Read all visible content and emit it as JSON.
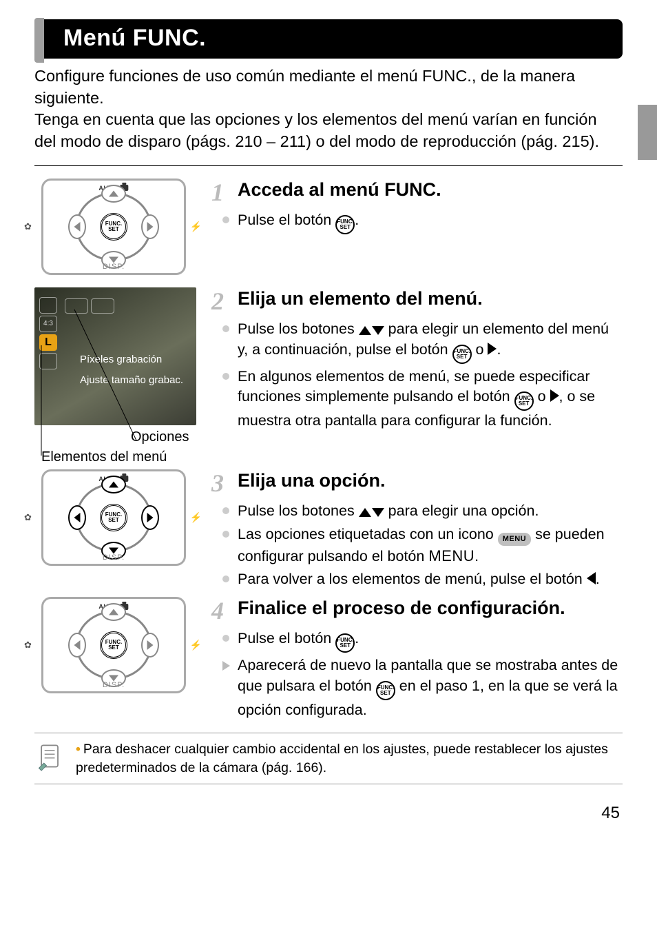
{
  "title": "Menú FUNC.",
  "intro": {
    "p1": "Configure funciones de uso común mediante el menú FUNC., de la manera siguiente.",
    "p2": "Tenga en cuenta que las opciones y los elementos del menú varían en función del modo de disparo (págs. 210 – 211) o del modo de reproducción (pág. 215)."
  },
  "labels": {
    "auto": "AUTO",
    "disp": "DISP.",
    "func_set": "FUNC. SET",
    "menu_pill": "MENU",
    "menu_word": "MENU"
  },
  "screenshot": {
    "strip": [
      "",
      "4:3",
      "L",
      ""
    ],
    "label1": "Píxeles grabación",
    "label2": "Ajuste tamaño grabac."
  },
  "captions": {
    "opciones": "Opciones",
    "elementos": "Elementos del menú"
  },
  "steps": [
    {
      "num": "1",
      "title": "Acceda al menú FUNC.",
      "items": [
        {
          "kind": "dot",
          "pre": "Pulse el botón ",
          "icon": "func",
          "post": "."
        }
      ]
    },
    {
      "num": "2",
      "title": "Elija un elemento del menú.",
      "items": [
        {
          "kind": "dot",
          "pre": "Pulse los botones ",
          "icon": "updown",
          "mid": " para elegir un elemento del menú y, a continuación, pulse el botón ",
          "icon2": "func",
          "mid2": " o ",
          "icon3": "right",
          "post": "."
        },
        {
          "kind": "dot",
          "pre": "En algunos elementos de menú, se puede especificar funciones simplemente pulsando el botón ",
          "icon": "func",
          "mid": " o ",
          "icon2": "right",
          "post": ", o se muestra otra pantalla para configurar la función."
        }
      ]
    },
    {
      "num": "3",
      "title": "Elija una opción.",
      "items": [
        {
          "kind": "dot",
          "pre": "Pulse los botones ",
          "icon": "updown",
          "post": " para elegir una opción."
        },
        {
          "kind": "dot",
          "pre": "Las opciones etiquetadas con un icono ",
          "icon": "menupill",
          "mid": " se pueden configurar pulsando el botón ",
          "icon2": "menuword",
          "post": "."
        },
        {
          "kind": "dot",
          "pre": "Para volver a los elementos de menú, pulse el botón ",
          "icon": "left",
          "post": "."
        }
      ]
    },
    {
      "num": "4",
      "title": "Finalice el proceso de configuración.",
      "items": [
        {
          "kind": "dot",
          "pre": "Pulse el botón ",
          "icon": "func",
          "post": "."
        },
        {
          "kind": "arrow",
          "pre": "Aparecerá de nuevo la pantalla que se mostraba antes de que pulsara el botón ",
          "icon": "func",
          "post": " en el paso 1, en la que se verá la opción configurada."
        }
      ]
    }
  ],
  "note": "Para deshacer cualquier cambio accidental en los ajustes, puede restablecer los ajustes predeterminados de la cámara (pág. 166).",
  "page_number": "45"
}
